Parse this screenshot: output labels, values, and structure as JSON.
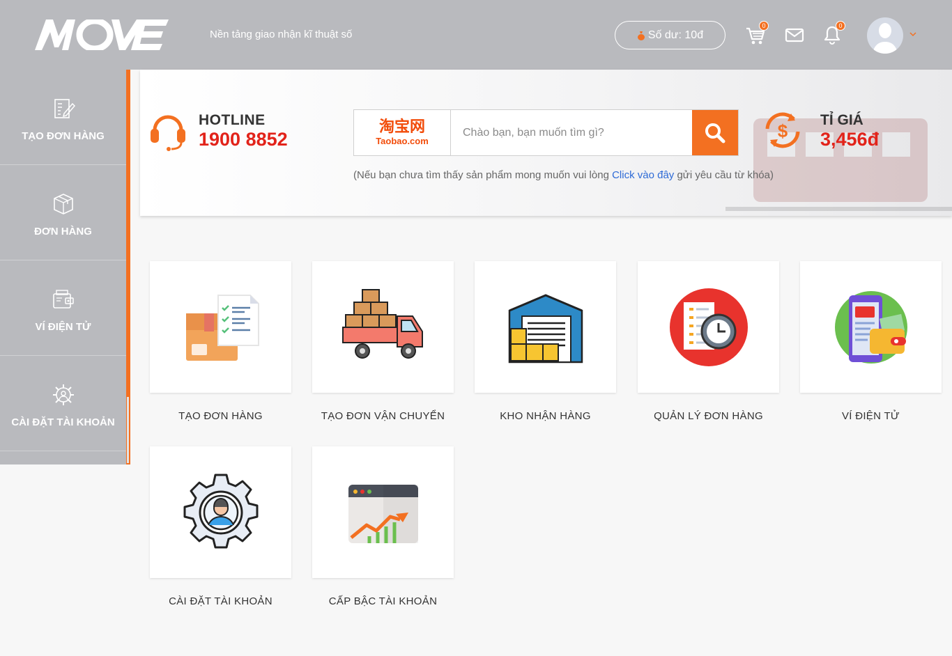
{
  "header": {
    "logo_text": "MOVE",
    "tagline": "Nền tảng giao nhận kĩ thuật số",
    "balance_label": "Số dư: 10đ",
    "cart_count": "0",
    "notification_count": "0"
  },
  "sidebar": {
    "items": [
      {
        "label": "TẠO ĐƠN HÀNG",
        "icon": "edit-document-icon"
      },
      {
        "label": "ĐƠN HÀNG",
        "icon": "package-box-icon"
      },
      {
        "label": "VÍ ĐIỆN TỬ",
        "icon": "wallet-icon"
      },
      {
        "label": "CÀI ĐẶT TÀI KHOẢN",
        "icon": "gear-user-icon"
      }
    ]
  },
  "banner": {
    "hotline_label": "HOTLINE",
    "hotline_number": "1900 8852",
    "search_source": {
      "cn": "淘宝网",
      "en": "Taobao.com"
    },
    "search_placeholder": "Chào bạn, bạn muốn tìm gì?",
    "hint_before": "(Nếu bạn chưa tìm thấy sản phẩm mong muốn vui lòng ",
    "hint_link": "Click vào đây",
    "hint_after": " gửi yêu cầu từ khóa)",
    "rate_label": "TỈ GIÁ",
    "rate_value": "3,456đ"
  },
  "tiles": [
    {
      "label": "TẠO ĐƠN HÀNG",
      "icon": "order-box-checklist-icon"
    },
    {
      "label": "TẠO ĐƠN VẬN CHUYỂN",
      "icon": "delivery-truck-icon"
    },
    {
      "label": "KHO NHẬN HÀNG",
      "icon": "warehouse-icon"
    },
    {
      "label": "QUẢN LÝ ĐƠN HÀNG",
      "icon": "order-clock-icon"
    },
    {
      "label": "VÍ ĐIỆN TỬ",
      "icon": "mobile-wallet-icon"
    },
    {
      "label": "CÀI ĐẶT TÀI KHOẢN",
      "icon": "account-settings-icon"
    },
    {
      "label": "CẤP BẬC TÀI KHOẢN",
      "icon": "growth-chart-icon"
    }
  ],
  "colors": {
    "header_bg": "#b9babe",
    "accent": "#f37021",
    "highlight_red": "#e2231a",
    "link_blue": "#2d6ad6"
  }
}
